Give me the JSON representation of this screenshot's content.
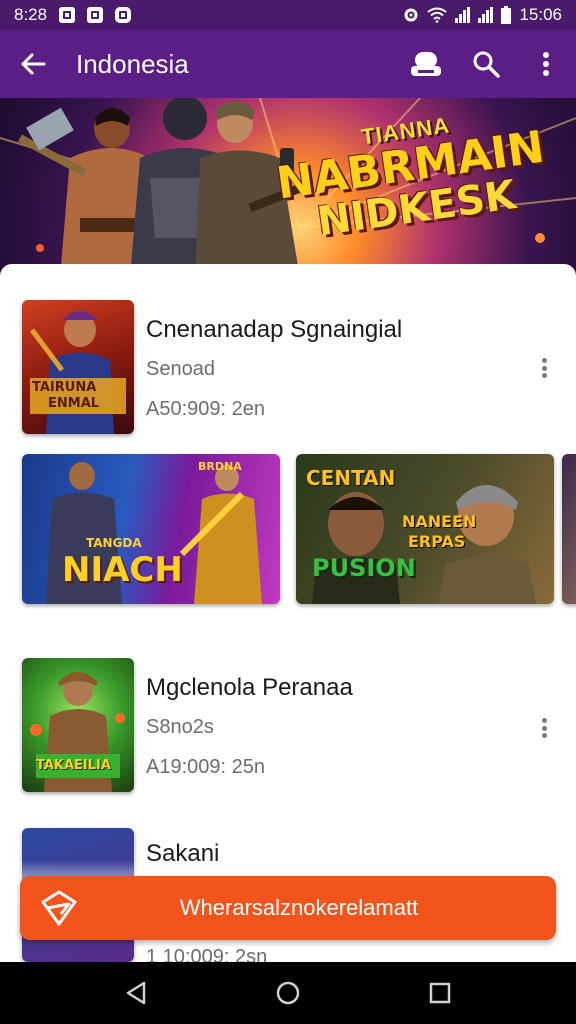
{
  "status_bar": {
    "time": "8:28",
    "clock": "15:06"
  },
  "app_bar": {
    "title": "Indonesia"
  },
  "banner": {
    "line1": "TIANNA",
    "line2": "NABRMAIN",
    "line3": "NIDKESK"
  },
  "items": [
    {
      "title": "Cnenanadap Sgnaingial",
      "subtitle": "Senoad",
      "meta": "A50:909: 2en",
      "thumb_text_1": "TAIRUNA",
      "thumb_text_2": "ENMAL"
    },
    {
      "title": "Mgclenola Peranaa",
      "subtitle": "S8no2s",
      "meta": "A19:009: 25n",
      "thumb_text_1": "TAKAEILIA"
    },
    {
      "title": "Sakani",
      "meta": "1 10:009: 2sn"
    }
  ],
  "carousel": [
    {
      "text_small": "TANGDA",
      "text_big": "NIACH"
    },
    {
      "text_small": "BRDNA"
    },
    {
      "text_top": "CENTAN",
      "text_mid": "NANEEN",
      "text_mid2": "ERPAS",
      "text_big": "PUSION"
    }
  ],
  "cta": {
    "label": "Wherarsalznokerelamatt"
  },
  "colors": {
    "app_bar": "#5b1e86",
    "status_bar": "#4a1a6b",
    "cta": "#f2541b"
  },
  "icons": [
    "back-arrow-icon",
    "profile-icon",
    "search-icon",
    "more-vert-icon",
    "nav-back-icon",
    "nav-home-icon",
    "nav-recents-icon"
  ]
}
